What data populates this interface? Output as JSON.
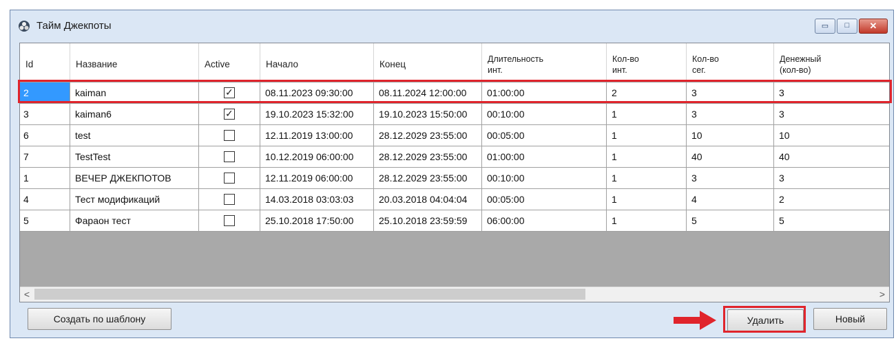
{
  "window": {
    "title": "Тайм Джекпоты",
    "app_icon": "jackpot-app-icon",
    "controls": {
      "minimize_icon": "minimize-icon",
      "maximize_icon": "maximize-icon",
      "close_icon": "close-icon",
      "minimize": "▭",
      "maximize": "□",
      "close": "✕"
    }
  },
  "table": {
    "columns": [
      "Id",
      "Название",
      "Active",
      "Начало",
      "Конец",
      "Длительность инт.",
      "Кол-во инт.",
      "Кол-во сег.",
      "Денежный (кол-во)"
    ],
    "column_lines": [
      [
        "Id"
      ],
      [
        "Название"
      ],
      [
        "Active"
      ],
      [
        "Начало"
      ],
      [
        "Конец"
      ],
      [
        "Длительность",
        "инт."
      ],
      [
        "Кол-во",
        "инт."
      ],
      [
        "Кол-во",
        "сег."
      ],
      [
        "Денежный",
        "(кол-во)"
      ]
    ],
    "rows": [
      {
        "id": "2",
        "name": "kaiman",
        "active": true,
        "start": "08.11.2023 09:30:00",
        "end": "08.11.2024 12:00:00",
        "duration": "01:00:00",
        "intervals": "2",
        "segments": "3",
        "money": "3",
        "selected": true
      },
      {
        "id": "3",
        "name": "kaiman6",
        "active": true,
        "start": "19.10.2023 15:32:00",
        "end": "19.10.2023 15:50:00",
        "duration": "00:10:00",
        "intervals": "1",
        "segments": "3",
        "money": "3",
        "selected": false
      },
      {
        "id": "6",
        "name": "test",
        "active": false,
        "start": "12.11.2019 13:00:00",
        "end": "28.12.2029 23:55:00",
        "duration": "00:05:00",
        "intervals": "1",
        "segments": "10",
        "money": "10",
        "selected": false
      },
      {
        "id": "7",
        "name": "TestTest",
        "active": false,
        "start": "10.12.2019 06:00:00",
        "end": "28.12.2029 23:55:00",
        "duration": "01:00:00",
        "intervals": "1",
        "segments": "40",
        "money": "40",
        "selected": false
      },
      {
        "id": "1",
        "name": "ВЕЧЕР ДЖЕКПОТОВ",
        "active": false,
        "start": "12.11.2019 06:00:00",
        "end": "28.12.2029 23:55:00",
        "duration": "00:10:00",
        "intervals": "1",
        "segments": "3",
        "money": "3",
        "selected": false
      },
      {
        "id": "4",
        "name": "Тест модификаций",
        "active": false,
        "start": "14.03.2018 03:03:03",
        "end": "20.03.2018 04:04:04",
        "duration": "00:05:00",
        "intervals": "1",
        "segments": "4",
        "money": "2",
        "selected": false
      },
      {
        "id": "5",
        "name": "Фараон тест",
        "active": false,
        "start": "25.10.2018 17:50:00",
        "end": "25.10.2018 23:59:59",
        "duration": "06:00:00",
        "intervals": "1",
        "segments": "5",
        "money": "5",
        "selected": false
      }
    ],
    "checkmark": "✓",
    "scroll_left": "<",
    "scroll_right": ">"
  },
  "buttons": {
    "template": "Создать по шаблону",
    "delete": "Удалить",
    "new": "Новый"
  },
  "annotation": {
    "color": "#e0242c",
    "arrow_icon": "red-arrow-icon"
  }
}
